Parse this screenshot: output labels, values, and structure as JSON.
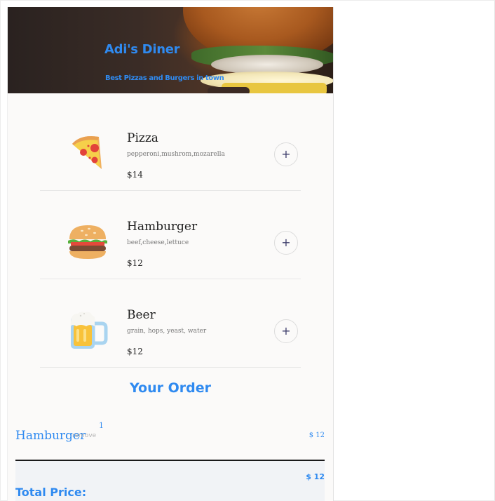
{
  "header": {
    "title": "Adi's Diner",
    "subtitle": "Best Pizzas and Burgers in town"
  },
  "menu": {
    "items": [
      {
        "name": "Pizza",
        "ingredients": "pepperoni,mushrom,mozarella",
        "price": "$14",
        "icon": "pizza-icon",
        "add_label": "+"
      },
      {
        "name": "Hamburger",
        "ingredients": "beef,cheese,lettuce",
        "price": "$12",
        "icon": "hamburger-icon",
        "add_label": "+"
      },
      {
        "name": "Beer",
        "ingredients": "grain, hops, yeast, water",
        "price": "$12",
        "icon": "beer-icon",
        "add_label": "+"
      }
    ]
  },
  "order": {
    "heading": "Your Order",
    "items": [
      {
        "quantity": "1",
        "name": "Hamburger",
        "remove_label": "remove",
        "price": "$ 12"
      }
    ],
    "total_label": "Total Price:",
    "total_value": "$ 12"
  },
  "colors": {
    "accent": "#2f8af0",
    "background": "#fbfaf9"
  }
}
